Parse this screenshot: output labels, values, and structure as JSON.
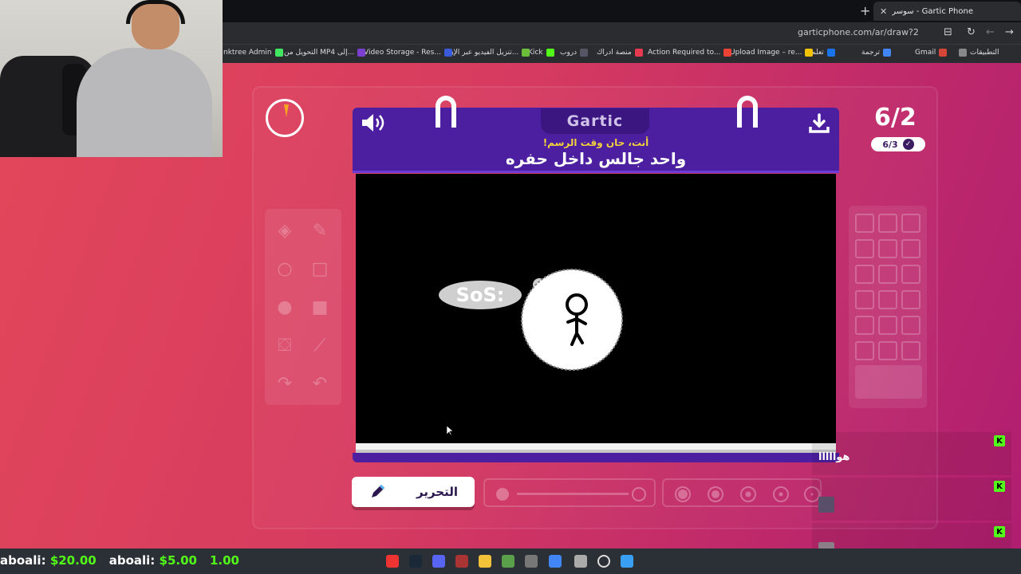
{
  "browser": {
    "tab_title": "Gartic Phone - سوسر",
    "url": "garticphone.com/ar/draw?2",
    "bookmarks": [
      "التطبيقات",
      "Gmail",
      "ترجمة",
      "تعلم",
      "Upload Image – re...",
      "Action Required to...",
      "منصة ادراك",
      "دروب",
      "Kick",
      "تنزيل الفيديو عبر الإن...",
      "Video Storage - Res...",
      "التحويل من MP4 إلى...",
      "nktree Admin"
    ]
  },
  "game": {
    "logo": "Gartic",
    "prompt_sub": "أنت، حان وقت الرسم!",
    "prompt_main": "واحد جالس داخل حفره",
    "round": "6/2",
    "round_done": "6/3",
    "edit_button": "التحرير",
    "drawing_text": "SoS:"
  },
  "chat": [
    {
      "message": "هوااااا"
    },
    {
      "message": ""
    },
    {
      "message": ""
    }
  ],
  "ticker": {
    "items": [
      {
        "name": "aboali",
        "amount": "$20.00"
      },
      {
        "name": "aboali",
        "amount": "$5.00"
      }
    ],
    "tail": "1.00"
  },
  "colors": {
    "board_purple": "#4b1fa0",
    "prompt_yellow": "#f3d23a",
    "kick_green": "#53fc18",
    "timer_orange": "#f5a623"
  }
}
